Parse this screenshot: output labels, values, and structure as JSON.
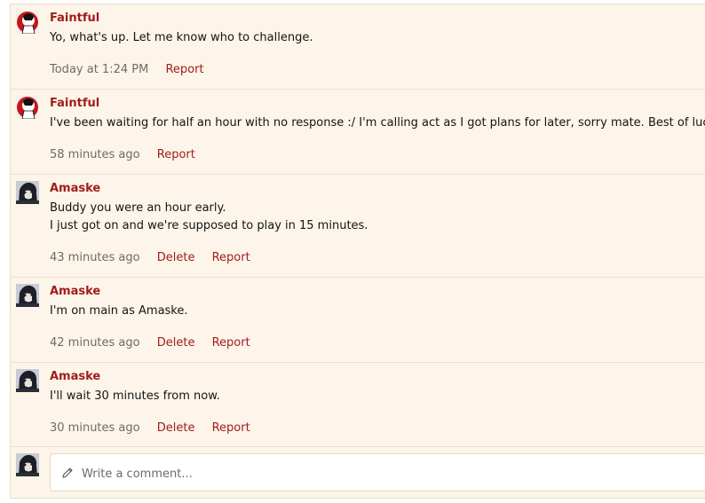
{
  "comments": [
    {
      "author": "Faintful",
      "avatar": "red-circle-avatar",
      "lines": [
        "Yo, what's up. Let me know who to challenge."
      ],
      "time": "Today at 1:24 PM",
      "actions": [
        "Report"
      ]
    },
    {
      "author": "Faintful",
      "avatar": "red-circle-avatar",
      "lines": [
        "I've been waiting for half an hour with no response :/ I'm calling act as I got plans for later, sorry mate. Best of luck."
      ],
      "time": "58 minutes ago",
      "actions": [
        "Report"
      ]
    },
    {
      "author": "Amaske",
      "avatar": "dark-anime-avatar",
      "lines": [
        "Buddy you were an hour early.",
        "I just got on and we're supposed to play in 15 minutes."
      ],
      "time": "43 minutes ago",
      "actions": [
        "Delete",
        "Report"
      ]
    },
    {
      "author": "Amaske",
      "avatar": "dark-anime-avatar",
      "lines": [
        "I'm on main as Amaske."
      ],
      "time": "42 minutes ago",
      "actions": [
        "Delete",
        "Report"
      ]
    },
    {
      "author": "Amaske",
      "avatar": "dark-anime-avatar",
      "lines": [
        "I'll wait 30 minutes from now."
      ],
      "time": "30 minutes ago",
      "actions": [
        "Delete",
        "Report"
      ]
    }
  ],
  "composer": {
    "placeholder": "Write a comment...",
    "icon": "pencil-icon"
  },
  "colors": {
    "background": "#fdf5e9",
    "link": "#a11d1d",
    "meta": "#6b6b6b"
  }
}
